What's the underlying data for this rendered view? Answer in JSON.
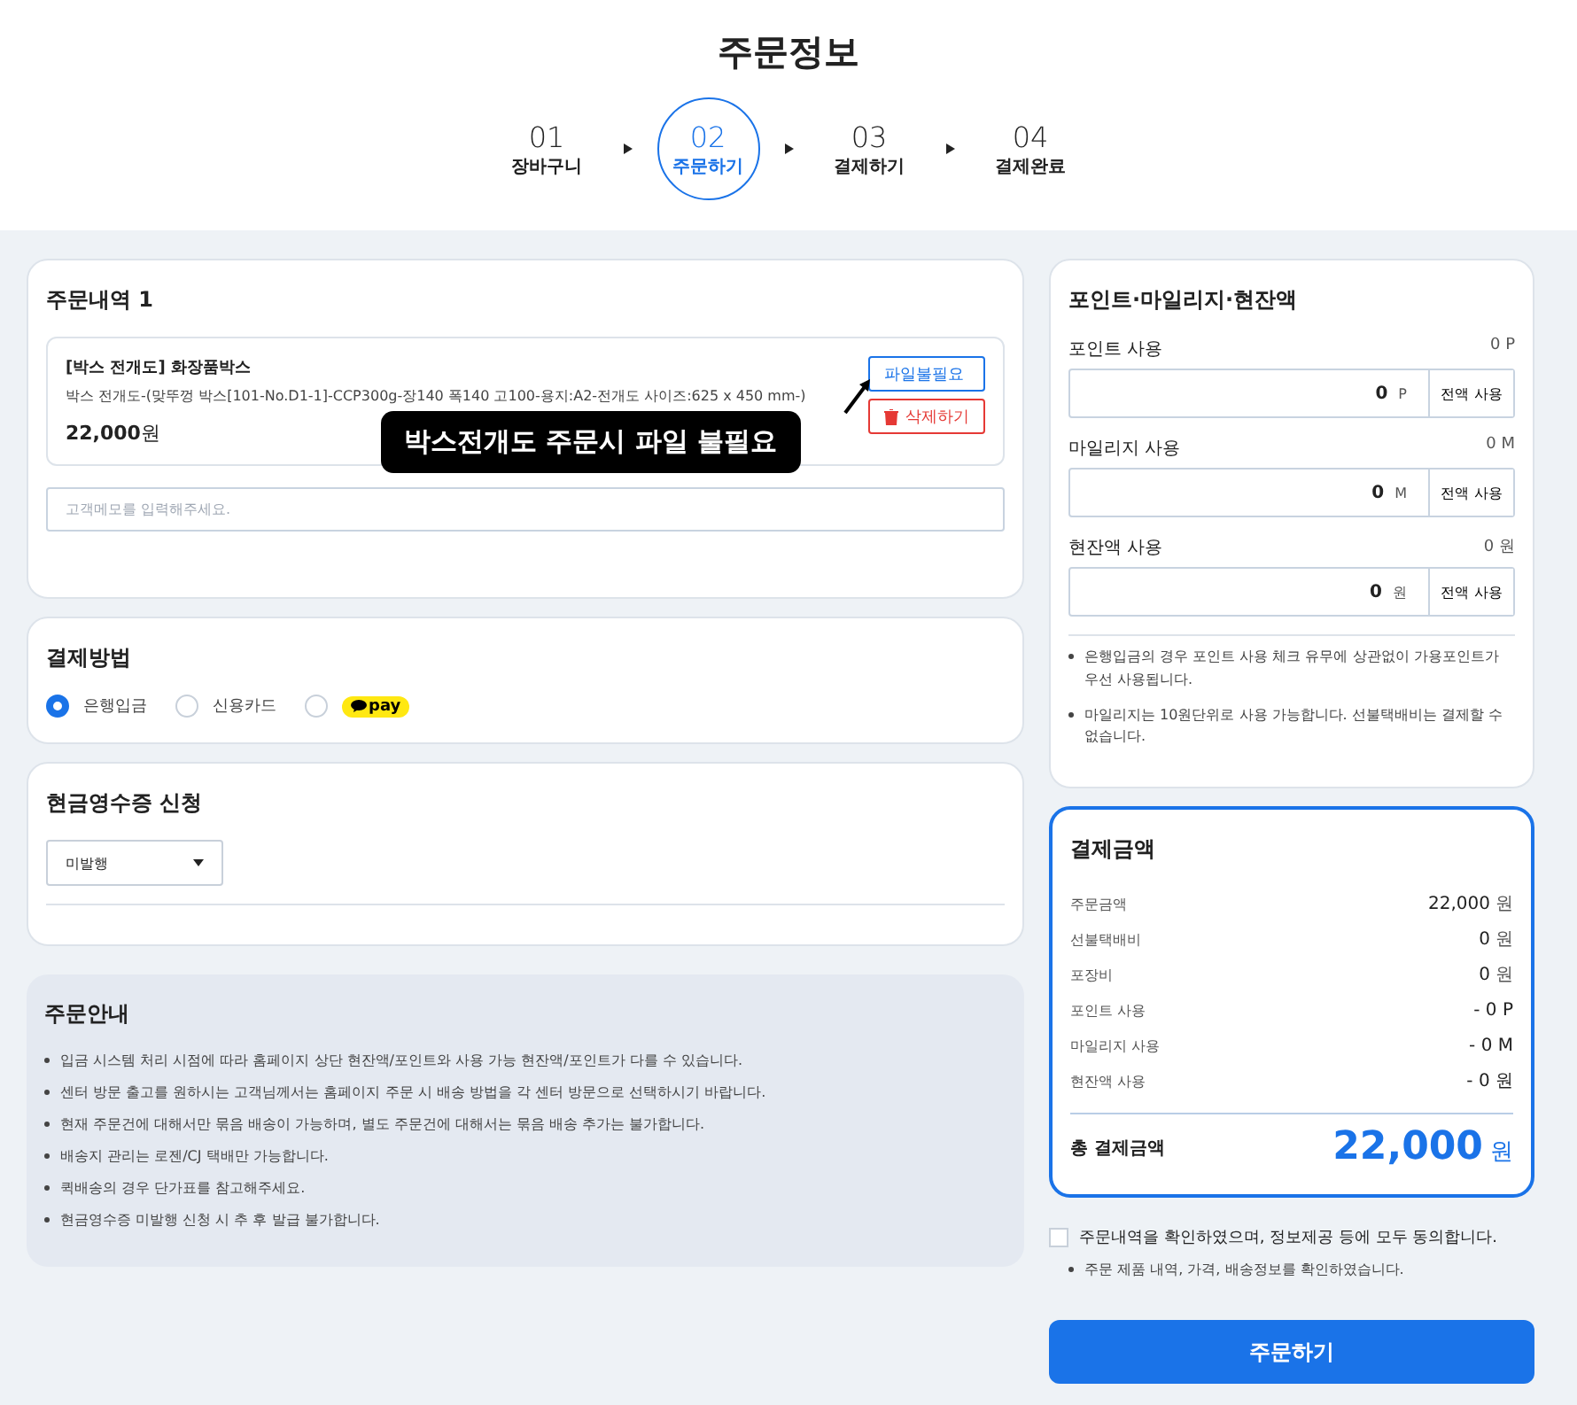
{
  "page_title": "주문정보",
  "steps": [
    {
      "number": "01",
      "label": "장바구니",
      "selected": false
    },
    {
      "number": "02",
      "label": "주문하기",
      "selected": true
    },
    {
      "number": "03",
      "label": "결제하기",
      "selected": false
    },
    {
      "number": "04",
      "label": "결제완료",
      "selected": false
    }
  ],
  "order": {
    "title": "주문내역 1",
    "item": {
      "name": "[박스 전개도] 화장품박스",
      "spec": "박스 전개도-(맞뚜껑 박스[101-No.D1-1]-CCP300g-장140 폭140 고100-용지:A2-전개도 사이즈:625 x 450 mm-)",
      "price": "22,000",
      "currency": "원",
      "file_button": "파일불필요",
      "delete_button": "삭제하기"
    },
    "callout": "박스전개도 주문시 파일 불필요",
    "memo": {
      "placeholder": "고객메모를 입력해주세요."
    }
  },
  "payment_method": {
    "title": "결제방법",
    "options": [
      {
        "kind": "text",
        "label": "은행입금",
        "selected": true
      },
      {
        "kind": "text",
        "label": "신용카드",
        "selected": false
      },
      {
        "kind": "logo",
        "label": "pay",
        "selected": false
      }
    ]
  },
  "receipt": {
    "title": "현금영수증 신청",
    "select": "미발행"
  },
  "guide": {
    "title": "주문안내",
    "items": [
      "입금 시스템 처리 시점에 따라 홈페이지 상단 현잔액/포인트와 사용 가능 현잔액/포인트가 다를 수 있습니다.",
      "센터 방문 출고를 원하시는 고객님께서는 홈페이지 주문 시 배송 방법을 각 센터 방문으로 선택하시기 바랍니다.",
      "현재 주문건에 대해서만 묶음 배송이 가능하며, 별도 주문건에 대해서는 묶음 배송 추가는 불가합니다.",
      "배송지 관리는 로젠/CJ 택배만 가능합니다.",
      "퀵배송의 경우 단가표를 참고해주세요.",
      "현금영수증 미발행 신청 시 추 후 발급 불가합니다."
    ]
  },
  "points": {
    "title": "포인트·마일리지·현잔액",
    "fields": [
      {
        "label": "포인트 사용",
        "available": "0 P",
        "value": "0",
        "unit": "P",
        "button": "전액 사용"
      },
      {
        "label": "마일리지 사용",
        "available": "0 M",
        "value": "0",
        "unit": "M",
        "button": "전액 사용"
      },
      {
        "label": "현잔액 사용",
        "available": "0 원",
        "value": "0",
        "unit": "원",
        "button": "전액 사용"
      }
    ],
    "notes": [
      "은행입금의 경우 포인트 사용 체크 유무에 상관없이 가용포인트가 우선 사용됩니다.",
      "마일리지는 10원단위로 사용 가능합니다. 선불택배비는 결제할 수 없습니다."
    ]
  },
  "summary": {
    "title": "결제금액",
    "rows": [
      {
        "label": "주문금액",
        "value": "22,000",
        "unit": "원"
      },
      {
        "label": "선불택배비",
        "value": "0",
        "unit": "원"
      },
      {
        "label": "포장비",
        "value": "0",
        "unit": "원"
      },
      {
        "label": "포인트 사용",
        "value": "- 0 P",
        "unit": ""
      },
      {
        "label": "마일리지 사용",
        "value": "- 0 M",
        "unit": ""
      },
      {
        "label": "현잔액 사용",
        "value": "- 0 원",
        "unit": ""
      }
    ],
    "total_label": "총 결제금액",
    "total_value": "22,000",
    "total_unit": "원"
  },
  "agreement": {
    "label": "주문내역을 확인하였으며, 정보제공 등에 모두 동의합니다.",
    "checked": false,
    "note": "주문 제품 내역, 가격, 배송정보를 확인하였습니다."
  },
  "submit": "주문하기"
}
